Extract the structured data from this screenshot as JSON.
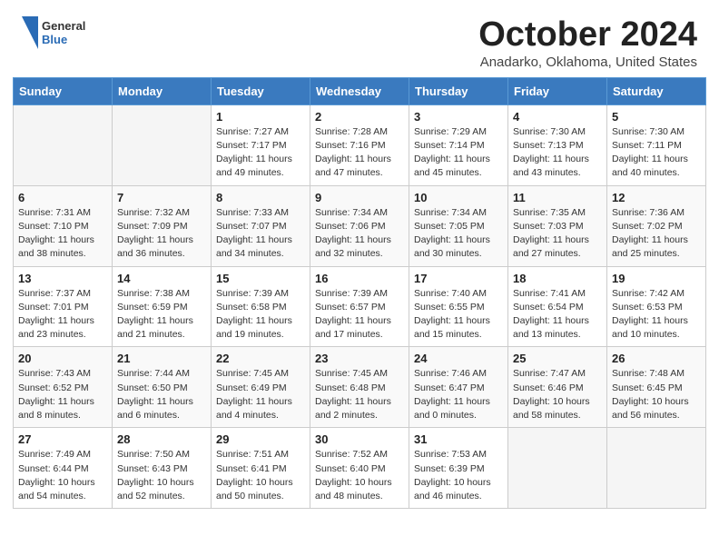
{
  "header": {
    "logo": {
      "general": "General",
      "blue": "Blue"
    },
    "title": "October 2024",
    "subtitle": "Anadarko, Oklahoma, United States"
  },
  "days_of_week": [
    "Sunday",
    "Monday",
    "Tuesday",
    "Wednesday",
    "Thursday",
    "Friday",
    "Saturday"
  ],
  "weeks": [
    [
      null,
      null,
      {
        "day": 1,
        "sunrise": "7:27 AM",
        "sunset": "7:17 PM",
        "daylight": "11 hours and 49 minutes."
      },
      {
        "day": 2,
        "sunrise": "7:28 AM",
        "sunset": "7:16 PM",
        "daylight": "11 hours and 47 minutes."
      },
      {
        "day": 3,
        "sunrise": "7:29 AM",
        "sunset": "7:14 PM",
        "daylight": "11 hours and 45 minutes."
      },
      {
        "day": 4,
        "sunrise": "7:30 AM",
        "sunset": "7:13 PM",
        "daylight": "11 hours and 43 minutes."
      },
      {
        "day": 5,
        "sunrise": "7:30 AM",
        "sunset": "7:11 PM",
        "daylight": "11 hours and 40 minutes."
      }
    ],
    [
      {
        "day": 6,
        "sunrise": "7:31 AM",
        "sunset": "7:10 PM",
        "daylight": "11 hours and 38 minutes."
      },
      {
        "day": 7,
        "sunrise": "7:32 AM",
        "sunset": "7:09 PM",
        "daylight": "11 hours and 36 minutes."
      },
      {
        "day": 8,
        "sunrise": "7:33 AM",
        "sunset": "7:07 PM",
        "daylight": "11 hours and 34 minutes."
      },
      {
        "day": 9,
        "sunrise": "7:34 AM",
        "sunset": "7:06 PM",
        "daylight": "11 hours and 32 minutes."
      },
      {
        "day": 10,
        "sunrise": "7:34 AM",
        "sunset": "7:05 PM",
        "daylight": "11 hours and 30 minutes."
      },
      {
        "day": 11,
        "sunrise": "7:35 AM",
        "sunset": "7:03 PM",
        "daylight": "11 hours and 27 minutes."
      },
      {
        "day": 12,
        "sunrise": "7:36 AM",
        "sunset": "7:02 PM",
        "daylight": "11 hours and 25 minutes."
      }
    ],
    [
      {
        "day": 13,
        "sunrise": "7:37 AM",
        "sunset": "7:01 PM",
        "daylight": "11 hours and 23 minutes."
      },
      {
        "day": 14,
        "sunrise": "7:38 AM",
        "sunset": "6:59 PM",
        "daylight": "11 hours and 21 minutes."
      },
      {
        "day": 15,
        "sunrise": "7:39 AM",
        "sunset": "6:58 PM",
        "daylight": "11 hours and 19 minutes."
      },
      {
        "day": 16,
        "sunrise": "7:39 AM",
        "sunset": "6:57 PM",
        "daylight": "11 hours and 17 minutes."
      },
      {
        "day": 17,
        "sunrise": "7:40 AM",
        "sunset": "6:55 PM",
        "daylight": "11 hours and 15 minutes."
      },
      {
        "day": 18,
        "sunrise": "7:41 AM",
        "sunset": "6:54 PM",
        "daylight": "11 hours and 13 minutes."
      },
      {
        "day": 19,
        "sunrise": "7:42 AM",
        "sunset": "6:53 PM",
        "daylight": "11 hours and 10 minutes."
      }
    ],
    [
      {
        "day": 20,
        "sunrise": "7:43 AM",
        "sunset": "6:52 PM",
        "daylight": "11 hours and 8 minutes."
      },
      {
        "day": 21,
        "sunrise": "7:44 AM",
        "sunset": "6:50 PM",
        "daylight": "11 hours and 6 minutes."
      },
      {
        "day": 22,
        "sunrise": "7:45 AM",
        "sunset": "6:49 PM",
        "daylight": "11 hours and 4 minutes."
      },
      {
        "day": 23,
        "sunrise": "7:45 AM",
        "sunset": "6:48 PM",
        "daylight": "11 hours and 2 minutes."
      },
      {
        "day": 24,
        "sunrise": "7:46 AM",
        "sunset": "6:47 PM",
        "daylight": "11 hours and 0 minutes."
      },
      {
        "day": 25,
        "sunrise": "7:47 AM",
        "sunset": "6:46 PM",
        "daylight": "10 hours and 58 minutes."
      },
      {
        "day": 26,
        "sunrise": "7:48 AM",
        "sunset": "6:45 PM",
        "daylight": "10 hours and 56 minutes."
      }
    ],
    [
      {
        "day": 27,
        "sunrise": "7:49 AM",
        "sunset": "6:44 PM",
        "daylight": "10 hours and 54 minutes."
      },
      {
        "day": 28,
        "sunrise": "7:50 AM",
        "sunset": "6:43 PM",
        "daylight": "10 hours and 52 minutes."
      },
      {
        "day": 29,
        "sunrise": "7:51 AM",
        "sunset": "6:41 PM",
        "daylight": "10 hours and 50 minutes."
      },
      {
        "day": 30,
        "sunrise": "7:52 AM",
        "sunset": "6:40 PM",
        "daylight": "10 hours and 48 minutes."
      },
      {
        "day": 31,
        "sunrise": "7:53 AM",
        "sunset": "6:39 PM",
        "daylight": "10 hours and 46 minutes."
      },
      null,
      null
    ]
  ]
}
